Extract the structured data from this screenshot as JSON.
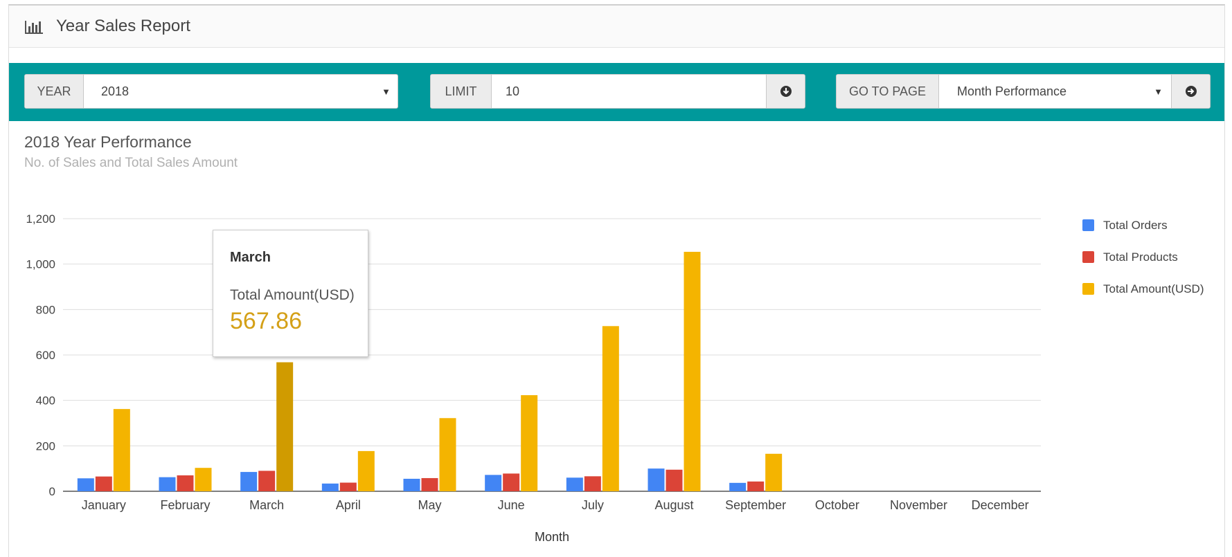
{
  "header": {
    "title": "Year Sales Report",
    "icon": "bar-chart-icon"
  },
  "toolbar": {
    "year_label": "YEAR",
    "year_value": "2018",
    "limit_label": "LIMIT",
    "limit_value": "10",
    "goto_label": "GO TO PAGE",
    "goto_value": "Month Performance",
    "color": "#00999b"
  },
  "chart_header": {
    "title": "2018 Year Performance",
    "subtitle": "No. of Sales and Total Sales Amount"
  },
  "tooltip": {
    "month": "March",
    "label": "Total Amount(USD)",
    "value": "567.86",
    "value_color": "#d4a017"
  },
  "chart_data": {
    "type": "bar",
    "xlabel": "Month",
    "ylabel": "",
    "ylim": [
      0,
      1200
    ],
    "yticks": [
      0,
      200,
      400,
      600,
      800,
      1000,
      1200
    ],
    "ytick_labels": [
      "0",
      "200",
      "400",
      "600",
      "800",
      "1,000",
      "1,200"
    ],
    "categories": [
      "January",
      "February",
      "March",
      "April",
      "May",
      "June",
      "July",
      "August",
      "September",
      "October",
      "November",
      "December"
    ],
    "series": [
      {
        "name": "Total Orders",
        "color": "#4285f4",
        "values": [
          57,
          62,
          85,
          34,
          55,
          72,
          60,
          100,
          37,
          0,
          0,
          0
        ]
      },
      {
        "name": "Total Products",
        "color": "#db4437",
        "values": [
          65,
          70,
          90,
          38,
          58,
          78,
          66,
          95,
          43,
          0,
          0,
          0
        ]
      },
      {
        "name": "Total Amount(USD)",
        "color": "#f4b400",
        "values": [
          362,
          103,
          567.86,
          177,
          322,
          423,
          727,
          1054,
          165,
          0,
          0,
          0
        ]
      }
    ],
    "highlight": {
      "series": 2,
      "category": 2,
      "color": "#d09b00"
    },
    "legend_position": "right",
    "grid": true
  }
}
